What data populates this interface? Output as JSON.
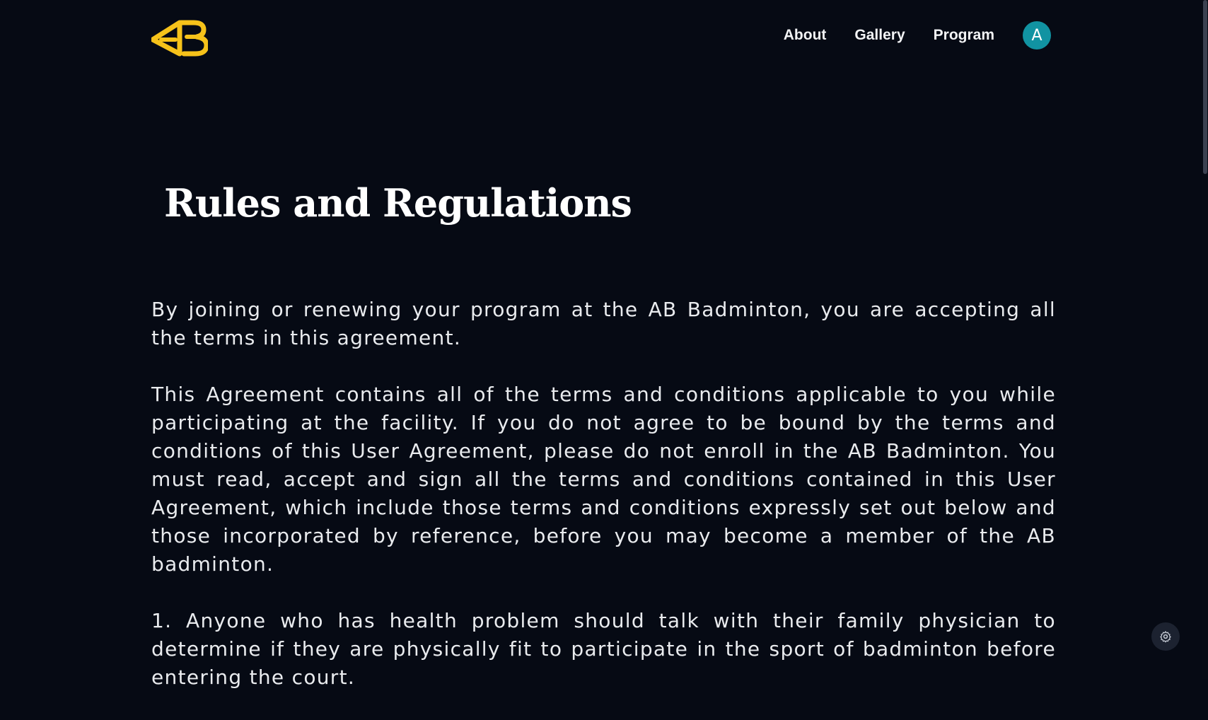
{
  "header": {
    "logo_text": "AB",
    "nav": [
      {
        "label": "About"
      },
      {
        "label": "Gallery"
      },
      {
        "label": "Program"
      }
    ],
    "avatar_initial": "A"
  },
  "main": {
    "title": "Rules and Regulations",
    "paragraphs": [
      "By joining or renewing your program at the AB Badminton, you are accepting all the terms in this agreement.",
      "This Agreement contains all of the terms and conditions applicable to you while participating at the facility. If you do not agree to be bound by the terms and conditions of this User Agreement, please do not enroll in the AB Badminton. You must read, accept and sign all the terms and conditions contained in this User Agreement, which include those terms and conditions expressly set out below and those incorporated by reference, before you may become a member of the AB badminton.",
      "1. Anyone who has health problem should talk with their family physician to determine if they are physically fit to participate in the sport of badminton before entering the court."
    ]
  },
  "colors": {
    "background": "#060a14",
    "accent_logo": "#f6c21a",
    "avatar": "#1193a2",
    "text": "#e9ebee"
  },
  "icons": {
    "settings_fab": "gear-icon"
  }
}
